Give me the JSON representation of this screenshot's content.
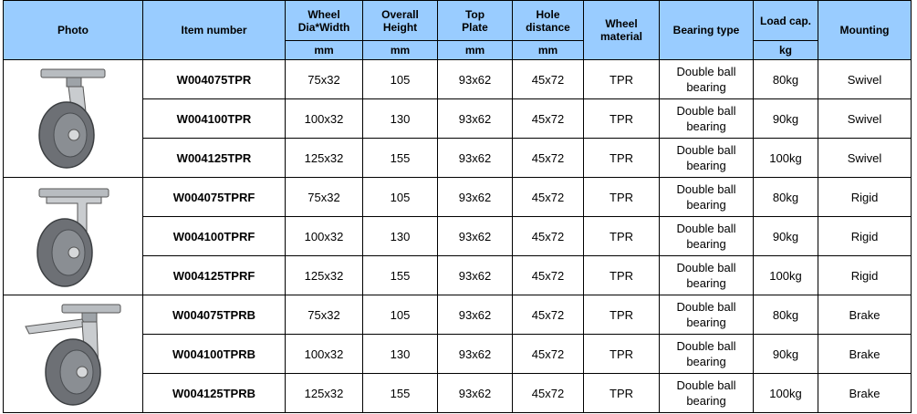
{
  "headers": {
    "photo": "Photo",
    "item_number": "Item number",
    "wheel_1": "Wheel",
    "wheel_2": "Dia*Width",
    "overall_1": "Overall",
    "overall_2": "Height",
    "top_1": "Top",
    "top_2": "Plate",
    "hole_1": "Hole",
    "hole_2": "distance",
    "material_1": "Wheel",
    "material_2": "material",
    "bearing": "Bearing type",
    "load": "Load cap.",
    "mounting": "Mounting"
  },
  "units": {
    "wheel": "mm",
    "overall": "mm",
    "top": "mm",
    "hole": "mm",
    "load": "kg"
  },
  "rows": [
    {
      "item": "W004075TPR",
      "wheel": "75x32",
      "height": "105",
      "plate": "93x62",
      "hole": "45x72",
      "material": "TPR",
      "bearing_1": "Double ball",
      "bearing_2": "bearing",
      "load": "80kg",
      "mounting": "Swivel"
    },
    {
      "item": "W004100TPR",
      "wheel": "100x32",
      "height": "130",
      "plate": "93x62",
      "hole": "45x72",
      "material": "TPR",
      "bearing_1": "Double ball",
      "bearing_2": "bearing",
      "load": "90kg",
      "mounting": "Swivel"
    },
    {
      "item": "W004125TPR",
      "wheel": "125x32",
      "height": "155",
      "plate": "93x62",
      "hole": "45x72",
      "material": "TPR",
      "bearing_1": "Double ball",
      "bearing_2": "bearing",
      "load": "100kg",
      "mounting": "Swivel"
    },
    {
      "item": "W004075TPRF",
      "wheel": "75x32",
      "height": "105",
      "plate": "93x62",
      "hole": "45x72",
      "material": "TPR",
      "bearing_1": "Double ball",
      "bearing_2": "bearing",
      "load": "80kg",
      "mounting": "Rigid"
    },
    {
      "item": "W004100TPRF",
      "wheel": "100x32",
      "height": "130",
      "plate": "93x62",
      "hole": "45x72",
      "material": "TPR",
      "bearing_1": "Double ball",
      "bearing_2": "bearing",
      "load": "90kg",
      "mounting": "Rigid"
    },
    {
      "item": "W004125TPRF",
      "wheel": "125x32",
      "height": "155",
      "plate": "93x62",
      "hole": "45x72",
      "material": "TPR",
      "bearing_1": "Double ball",
      "bearing_2": "bearing",
      "load": "100kg",
      "mounting": "Rigid"
    },
    {
      "item": "W004075TPRB",
      "wheel": "75x32",
      "height": "105",
      "plate": "93x62",
      "hole": "45x72",
      "material": "TPR",
      "bearing_1": "Double ball",
      "bearing_2": "bearing",
      "load": "80kg",
      "mounting": "Brake"
    },
    {
      "item": "W004100TPRB",
      "wheel": "100x32",
      "height": "130",
      "plate": "93x62",
      "hole": "45x72",
      "material": "TPR",
      "bearing_1": "Double ball",
      "bearing_2": "bearing",
      "load": "90kg",
      "mounting": "Brake"
    },
    {
      "item": "W004125TPRB",
      "wheel": "125x32",
      "height": "155",
      "plate": "93x62",
      "hole": "45x72",
      "material": "TPR",
      "bearing_1": "Double ball",
      "bearing_2": "bearing",
      "load": "100kg",
      "mounting": "Brake"
    }
  ],
  "photos": [
    {
      "icon": "swivel-caster-icon"
    },
    {
      "icon": "rigid-caster-icon"
    },
    {
      "icon": "brake-caster-icon"
    }
  ],
  "colors": {
    "header_bg": "#99ccff",
    "border": "#000000",
    "wheel_grey": "#6d7075",
    "metal": "#c9cccf"
  }
}
